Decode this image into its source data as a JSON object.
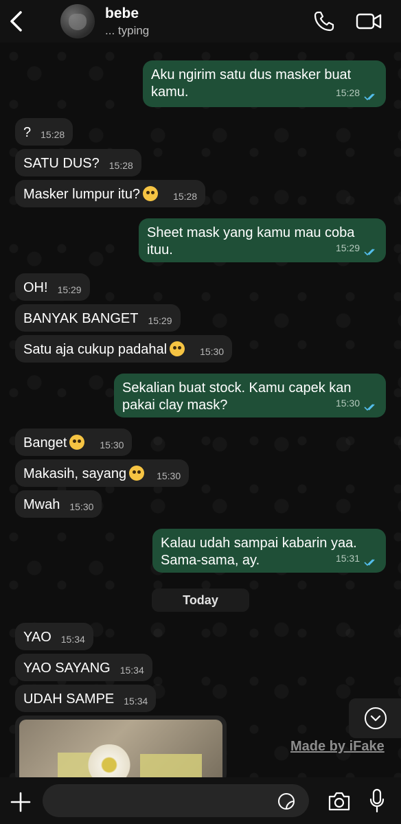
{
  "header": {
    "back_icon": "chevron-left-icon",
    "contact_name": "bebe",
    "status": "... typing",
    "call_icon": "phone-icon",
    "video_icon": "video-camera-icon"
  },
  "messages": [
    {
      "dir": "out",
      "lines": [
        "Aku ngirim satu dus masker buat",
        "kamu."
      ],
      "time": "15:28",
      "read": true
    },
    {
      "dir": "in",
      "text": "?",
      "time": "15:28"
    },
    {
      "dir": "in",
      "text": "SATU DUS?",
      "time": "15:28"
    },
    {
      "dir": "in",
      "text": "Masker lumpur itu?",
      "emoji": "pleading-face",
      "time": "15:28"
    },
    {
      "dir": "out",
      "lines": [
        "Sheet mask yang kamu mau coba",
        "ituu."
      ],
      "time": "15:29",
      "read": true
    },
    {
      "dir": "in",
      "text": "OH!",
      "time": "15:29"
    },
    {
      "dir": "in",
      "text": "BANYAK BANGET",
      "time": "15:29"
    },
    {
      "dir": "in",
      "text": "Satu aja cukup padahal",
      "emoji": "weary-face",
      "time": "15:30"
    },
    {
      "dir": "out",
      "lines": [
        "Sekalian buat stock. Kamu capek kan",
        "pakai clay mask?"
      ],
      "time": "15:30",
      "read": true
    },
    {
      "dir": "in",
      "text": "Banget",
      "emoji": "frowning-face",
      "time": "15:30"
    },
    {
      "dir": "in",
      "text": "Makasih, sayang",
      "emoji": "kissing-face",
      "time": "15:30"
    },
    {
      "dir": "in",
      "text": "Mwah",
      "time": "15:30"
    },
    {
      "dir": "out",
      "lines": [
        "Kalau udah sampai kabarin yaa.",
        "Sama-sama, ay."
      ],
      "time": "15:31",
      "read": true
    },
    {
      "dir": "in",
      "text": "YAO",
      "time": "15:34"
    },
    {
      "dir": "in",
      "text": "YAO SAYANG",
      "time": "15:34"
    },
    {
      "dir": "in",
      "text": "UDAH SAMPE",
      "time": "15:34"
    }
  ],
  "date_separator": "Today",
  "watermark": "Made by iFake",
  "input": {
    "placeholder": ""
  },
  "colors": {
    "outgoing_bubble": "#1f4f37",
    "incoming_bubble": "#222222",
    "read_ticks": "#53bdeb"
  }
}
